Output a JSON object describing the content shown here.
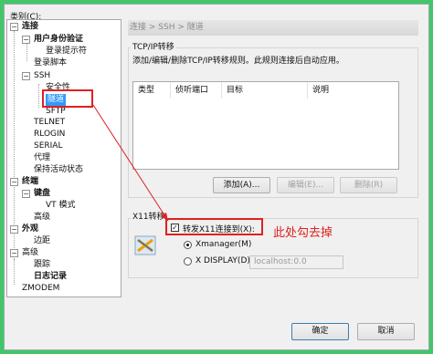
{
  "category_label": "类别(C):",
  "tree": {
    "connection": "连接",
    "user_auth": "用户身份验证",
    "login_prompt": "登录提示符",
    "login_script": "登录脚本",
    "ssh": "SSH",
    "security": "安全性",
    "tunnel": "隧道",
    "sftp": "SFTP",
    "telnet": "TELNET",
    "rlogin": "RLOGIN",
    "serial": "SERIAL",
    "proxy": "代理",
    "keepalive": "保持活动状态",
    "terminal": "终端",
    "keyboard": "键盘",
    "vt_mode": "VT 模式",
    "advanced1": "高级",
    "appearance": "外观",
    "margin": "边距",
    "advanced2": "高级",
    "trace": "跟踪",
    "logging": "日志记录",
    "zmodem": "ZMODEM"
  },
  "breadcrumb": "连接 > SSH > 隧道",
  "tcpip": {
    "title": "TCP/IP转移",
    "description": "添加/编辑/删除TCP/IP转移规则。此规则连接后自动应用。",
    "columns": [
      "类型",
      "侦听端口",
      "目标",
      "说明"
    ],
    "add": "添加(A)...",
    "edit": "编辑(E)...",
    "delete": "删除(R)"
  },
  "x11": {
    "title": "X11转移",
    "forward_label": "转发X11连接到(X):",
    "xmanager_label": "Xmanager(M)",
    "xdisplay_label": "X DISPLAY(D):",
    "xdisplay_value": "localhost:0.0"
  },
  "annotation": "此处勾去掉",
  "buttons": {
    "ok": "确定",
    "cancel": "取消"
  },
  "colors": {
    "accent": "#3399ff",
    "annotation": "#e02020",
    "background": "#43c66a"
  }
}
